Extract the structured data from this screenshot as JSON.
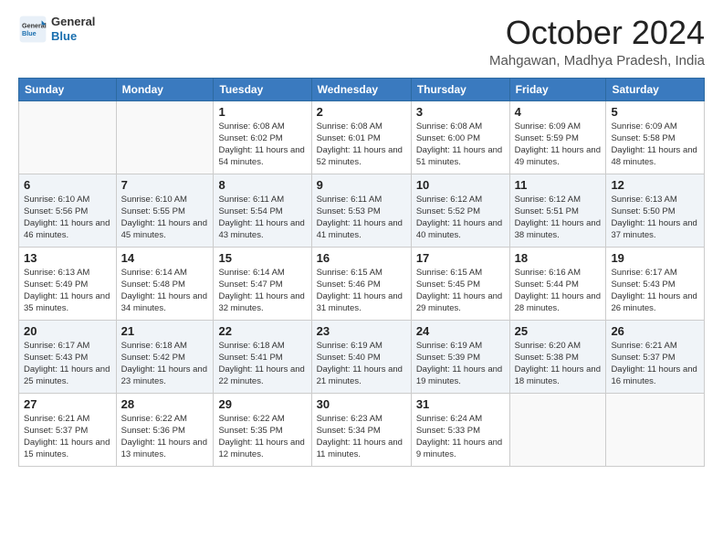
{
  "logo": {
    "general": "General",
    "blue": "Blue"
  },
  "title": "October 2024",
  "location": "Mahgawan, Madhya Pradesh, India",
  "weekdays": [
    "Sunday",
    "Monday",
    "Tuesday",
    "Wednesday",
    "Thursday",
    "Friday",
    "Saturday"
  ],
  "weeks": [
    [
      {
        "day": "",
        "info": ""
      },
      {
        "day": "",
        "info": ""
      },
      {
        "day": "1",
        "info": "Sunrise: 6:08 AM\nSunset: 6:02 PM\nDaylight: 11 hours and 54 minutes."
      },
      {
        "day": "2",
        "info": "Sunrise: 6:08 AM\nSunset: 6:01 PM\nDaylight: 11 hours and 52 minutes."
      },
      {
        "day": "3",
        "info": "Sunrise: 6:08 AM\nSunset: 6:00 PM\nDaylight: 11 hours and 51 minutes."
      },
      {
        "day": "4",
        "info": "Sunrise: 6:09 AM\nSunset: 5:59 PM\nDaylight: 11 hours and 49 minutes."
      },
      {
        "day": "5",
        "info": "Sunrise: 6:09 AM\nSunset: 5:58 PM\nDaylight: 11 hours and 48 minutes."
      }
    ],
    [
      {
        "day": "6",
        "info": "Sunrise: 6:10 AM\nSunset: 5:56 PM\nDaylight: 11 hours and 46 minutes."
      },
      {
        "day": "7",
        "info": "Sunrise: 6:10 AM\nSunset: 5:55 PM\nDaylight: 11 hours and 45 minutes."
      },
      {
        "day": "8",
        "info": "Sunrise: 6:11 AM\nSunset: 5:54 PM\nDaylight: 11 hours and 43 minutes."
      },
      {
        "day": "9",
        "info": "Sunrise: 6:11 AM\nSunset: 5:53 PM\nDaylight: 11 hours and 41 minutes."
      },
      {
        "day": "10",
        "info": "Sunrise: 6:12 AM\nSunset: 5:52 PM\nDaylight: 11 hours and 40 minutes."
      },
      {
        "day": "11",
        "info": "Sunrise: 6:12 AM\nSunset: 5:51 PM\nDaylight: 11 hours and 38 minutes."
      },
      {
        "day": "12",
        "info": "Sunrise: 6:13 AM\nSunset: 5:50 PM\nDaylight: 11 hours and 37 minutes."
      }
    ],
    [
      {
        "day": "13",
        "info": "Sunrise: 6:13 AM\nSunset: 5:49 PM\nDaylight: 11 hours and 35 minutes."
      },
      {
        "day": "14",
        "info": "Sunrise: 6:14 AM\nSunset: 5:48 PM\nDaylight: 11 hours and 34 minutes."
      },
      {
        "day": "15",
        "info": "Sunrise: 6:14 AM\nSunset: 5:47 PM\nDaylight: 11 hours and 32 minutes."
      },
      {
        "day": "16",
        "info": "Sunrise: 6:15 AM\nSunset: 5:46 PM\nDaylight: 11 hours and 31 minutes."
      },
      {
        "day": "17",
        "info": "Sunrise: 6:15 AM\nSunset: 5:45 PM\nDaylight: 11 hours and 29 minutes."
      },
      {
        "day": "18",
        "info": "Sunrise: 6:16 AM\nSunset: 5:44 PM\nDaylight: 11 hours and 28 minutes."
      },
      {
        "day": "19",
        "info": "Sunrise: 6:17 AM\nSunset: 5:43 PM\nDaylight: 11 hours and 26 minutes."
      }
    ],
    [
      {
        "day": "20",
        "info": "Sunrise: 6:17 AM\nSunset: 5:43 PM\nDaylight: 11 hours and 25 minutes."
      },
      {
        "day": "21",
        "info": "Sunrise: 6:18 AM\nSunset: 5:42 PM\nDaylight: 11 hours and 23 minutes."
      },
      {
        "day": "22",
        "info": "Sunrise: 6:18 AM\nSunset: 5:41 PM\nDaylight: 11 hours and 22 minutes."
      },
      {
        "day": "23",
        "info": "Sunrise: 6:19 AM\nSunset: 5:40 PM\nDaylight: 11 hours and 21 minutes."
      },
      {
        "day": "24",
        "info": "Sunrise: 6:19 AM\nSunset: 5:39 PM\nDaylight: 11 hours and 19 minutes."
      },
      {
        "day": "25",
        "info": "Sunrise: 6:20 AM\nSunset: 5:38 PM\nDaylight: 11 hours and 18 minutes."
      },
      {
        "day": "26",
        "info": "Sunrise: 6:21 AM\nSunset: 5:37 PM\nDaylight: 11 hours and 16 minutes."
      }
    ],
    [
      {
        "day": "27",
        "info": "Sunrise: 6:21 AM\nSunset: 5:37 PM\nDaylight: 11 hours and 15 minutes."
      },
      {
        "day": "28",
        "info": "Sunrise: 6:22 AM\nSunset: 5:36 PM\nDaylight: 11 hours and 13 minutes."
      },
      {
        "day": "29",
        "info": "Sunrise: 6:22 AM\nSunset: 5:35 PM\nDaylight: 11 hours and 12 minutes."
      },
      {
        "day": "30",
        "info": "Sunrise: 6:23 AM\nSunset: 5:34 PM\nDaylight: 11 hours and 11 minutes."
      },
      {
        "day": "31",
        "info": "Sunrise: 6:24 AM\nSunset: 5:33 PM\nDaylight: 11 hours and 9 minutes."
      },
      {
        "day": "",
        "info": ""
      },
      {
        "day": "",
        "info": ""
      }
    ]
  ]
}
